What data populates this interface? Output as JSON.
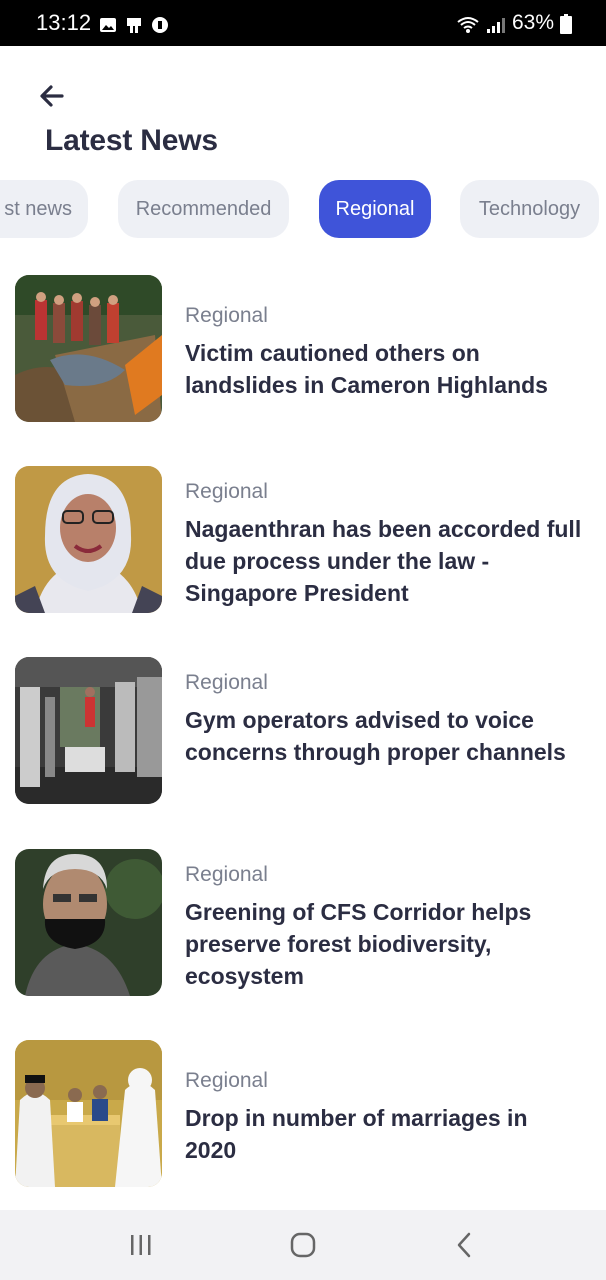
{
  "status_bar": {
    "time": "13:12",
    "battery": "63%",
    "icons": [
      "image-icon",
      "cast-icon",
      "app-icon",
      "wifi-icon",
      "signal-icon",
      "battery-icon"
    ]
  },
  "header": {
    "back_icon": "arrow-left-icon",
    "title": "Latest News"
  },
  "tabs": [
    {
      "label": "Latest news",
      "visible_label": "st news",
      "active": false
    },
    {
      "label": "Recommended",
      "active": false
    },
    {
      "label": "Regional",
      "active": true
    },
    {
      "label": "Technology",
      "active": false
    }
  ],
  "news": [
    {
      "category": "Regional",
      "headline": "Victim cautioned others on landslides in Cameron Highlands"
    },
    {
      "category": "Regional",
      "headline": "Nagaenthran has been accorded full due process under the law - Singapore President"
    },
    {
      "category": "Regional",
      "headline": "Gym operators advised to voice concerns through proper channels"
    },
    {
      "category": "Regional",
      "headline": "Greening of CFS Corridor helps preserve forest biodiversity, ecosystem"
    },
    {
      "category": "Regional",
      "headline": "Drop in number of marriages in 2020"
    }
  ],
  "nav_bar": {
    "icons": [
      "recent-apps-icon",
      "home-icon",
      "back-nav-icon"
    ]
  },
  "colors": {
    "accent": "#3f54d9",
    "tab_bg": "#eef0f5",
    "text_primary": "#2b2d42",
    "text_secondary": "#7a7f8e"
  }
}
